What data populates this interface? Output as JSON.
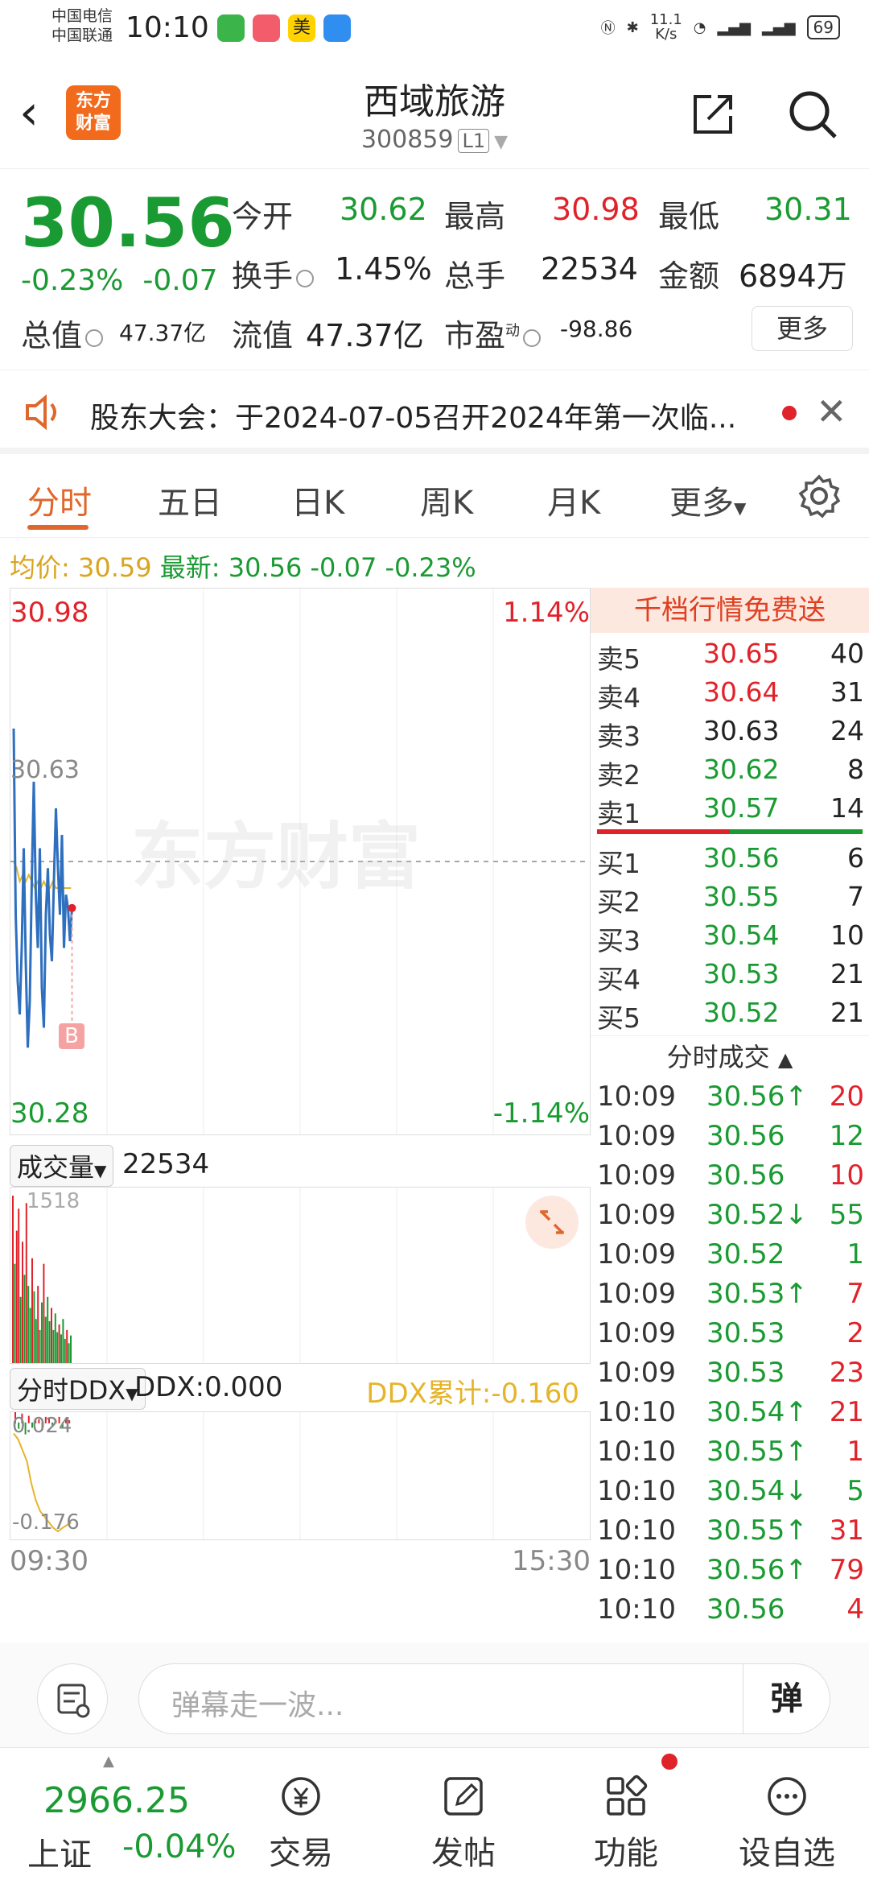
{
  "status": {
    "carrier1": "中国电信",
    "carrier2": "中国联通",
    "time": "10:10",
    "net_speed": "11.1\nK/s",
    "net_speed_val": "11.1",
    "net_speed_unit": "K/s",
    "battery": "69",
    "app_mei": "美"
  },
  "header": {
    "title": "西域旅游",
    "code": "300859",
    "level": "L1",
    "logo_line1": "东方",
    "logo_line2": "财富"
  },
  "quote": {
    "price": "30.56",
    "change_pct": "-0.23%",
    "change": "-0.07",
    "open_label": "今开",
    "open": "30.62",
    "high_label": "最高",
    "high": "30.98",
    "low_label": "最低",
    "low": "30.31",
    "turnover_label": "换手",
    "turnover": "1.45%",
    "volume_label": "总手",
    "volume": "22534",
    "amount_label": "金额",
    "amount": "6894万",
    "mcap_label": "总值",
    "mcap": "47.37亿",
    "float_label": "流值",
    "float": "47.37亿",
    "pe_label": "市盈",
    "pe_sup": "动",
    "pe": "-98.86",
    "more_label": "更多"
  },
  "notice": {
    "text": "股东大会：于2024-07-05召开2024年第一次临..."
  },
  "tabs": [
    "分时",
    "五日",
    "日K",
    "周K",
    "月K",
    "更多"
  ],
  "avg": {
    "avg_label": "均价:",
    "avg_value": "30.59",
    "latest_label": "最新:",
    "latest_value": "30.56",
    "latest_change": "-0.07",
    "latest_pct": "-0.23%"
  },
  "chart": {
    "top_price": "30.98",
    "top_pct": "1.14%",
    "bottom_price": "30.28",
    "bottom_pct": "-1.14%",
    "mid_price": "30.63",
    "watermark": "东方财富",
    "marker": "B",
    "time_start": "09:30",
    "time_end": "15:30"
  },
  "chart_data": {
    "type": "line",
    "ylim": [
      30.28,
      30.98
    ],
    "prev_close": 30.63,
    "price": [
      30.83,
      30.55,
      30.45,
      30.4,
      30.5,
      30.65,
      30.48,
      30.35,
      30.42,
      30.6,
      30.75,
      30.58,
      30.5,
      30.65,
      30.44,
      30.38,
      30.55,
      30.62,
      30.52,
      30.48,
      30.6,
      30.71,
      30.62,
      30.55,
      30.67,
      30.5,
      30.58,
      30.56,
      30.51,
      30.56
    ],
    "avg_price": [
      30.63,
      30.62,
      30.6,
      30.61,
      30.6,
      30.61,
      30.6,
      30.59,
      30.6,
      30.59,
      30.6,
      30.59,
      30.59,
      30.6,
      30.59,
      30.59,
      30.59,
      30.59,
      30.59,
      30.59
    ],
    "volume_max": 1518,
    "volume": [
      1518,
      900,
      1200,
      1400,
      600,
      1100,
      800,
      1450,
      700,
      500,
      950,
      650,
      400,
      700,
      300,
      550,
      900,
      420,
      600,
      380,
      500,
      300,
      450,
      280,
      350,
      260,
      400,
      220,
      300,
      180,
      250
    ],
    "volume_colors": [
      "r",
      "g",
      "r",
      "r",
      "g",
      "r",
      "g",
      "r",
      "g",
      "g",
      "r",
      "g",
      "g",
      "r",
      "g",
      "g",
      "r",
      "g",
      "g",
      "g",
      "r",
      "g",
      "g",
      "g",
      "r",
      "g",
      "g",
      "g",
      "r",
      "g",
      "g"
    ],
    "ddx_top": "0.024",
    "ddx_bottom": "-0.176",
    "ddx_cumulative": [
      0.0,
      -0.01,
      -0.03,
      -0.05,
      -0.09,
      -0.12,
      -0.14,
      -0.15,
      -0.16,
      -0.17,
      -0.176,
      -0.17,
      -0.165,
      -0.16
    ],
    "ddx_bars": [
      0.01,
      -0.005,
      0.008,
      -0.01,
      0.006,
      -0.004,
      0.004,
      0.003,
      -0.006,
      0.005,
      0.004,
      -0.003,
      0.002,
      0.005,
      -0.004,
      0.003,
      0.002
    ]
  },
  "volume_panel": {
    "label": "成交量",
    "value": "22534",
    "max_label": "1518"
  },
  "ddx_panel": {
    "label": "分时DDX",
    "ddx": "DDX:0.000",
    "cum": "DDX累计:-0.160"
  },
  "book": {
    "head": "千档行情免费送",
    "asks": [
      {
        "label": "卖5",
        "price": "30.65",
        "vol": "40",
        "color": "red"
      },
      {
        "label": "卖4",
        "price": "30.64",
        "vol": "31",
        "color": "red"
      },
      {
        "label": "卖3",
        "price": "30.63",
        "vol": "24",
        "color": "black"
      },
      {
        "label": "卖2",
        "price": "30.62",
        "vol": "8",
        "color": "green"
      },
      {
        "label": "卖1",
        "price": "30.57",
        "vol": "14",
        "color": "green"
      }
    ],
    "bids": [
      {
        "label": "买1",
        "price": "30.56",
        "vol": "6",
        "color": "green"
      },
      {
        "label": "买2",
        "price": "30.55",
        "vol": "7",
        "color": "green"
      },
      {
        "label": "买3",
        "price": "30.54",
        "vol": "10",
        "color": "green"
      },
      {
        "label": "买4",
        "price": "30.53",
        "vol": "21",
        "color": "green"
      },
      {
        "label": "买5",
        "price": "30.52",
        "vol": "21",
        "color": "green"
      }
    ],
    "ticks_head": "分时成交",
    "ticks": [
      {
        "t": "10:09",
        "p": "30.56",
        "arrow": "↑",
        "v": "20",
        "pc": "green",
        "vc": "red"
      },
      {
        "t": "10:09",
        "p": "30.56",
        "arrow": "",
        "v": "12",
        "pc": "green",
        "vc": "green"
      },
      {
        "t": "10:09",
        "p": "30.56",
        "arrow": "",
        "v": "10",
        "pc": "green",
        "vc": "red"
      },
      {
        "t": "10:09",
        "p": "30.52",
        "arrow": "↓",
        "v": "55",
        "pc": "green",
        "vc": "green"
      },
      {
        "t": "10:09",
        "p": "30.52",
        "arrow": "",
        "v": "1",
        "pc": "green",
        "vc": "green"
      },
      {
        "t": "10:09",
        "p": "30.53",
        "arrow": "↑",
        "v": "7",
        "pc": "green",
        "vc": "red"
      },
      {
        "t": "10:09",
        "p": "30.53",
        "arrow": "",
        "v": "2",
        "pc": "green",
        "vc": "red"
      },
      {
        "t": "10:09",
        "p": "30.53",
        "arrow": "",
        "v": "23",
        "pc": "green",
        "vc": "red"
      },
      {
        "t": "10:10",
        "p": "30.54",
        "arrow": "↑",
        "v": "21",
        "pc": "green",
        "vc": "red"
      },
      {
        "t": "10:10",
        "p": "30.55",
        "arrow": "↑",
        "v": "1",
        "pc": "green",
        "vc": "red"
      },
      {
        "t": "10:10",
        "p": "30.54",
        "arrow": "↓",
        "v": "5",
        "pc": "green",
        "vc": "green"
      },
      {
        "t": "10:10",
        "p": "30.55",
        "arrow": "↑",
        "v": "31",
        "pc": "green",
        "vc": "red"
      },
      {
        "t": "10:10",
        "p": "30.56",
        "arrow": "↑",
        "v": "79",
        "pc": "green",
        "vc": "red"
      },
      {
        "t": "10:10",
        "p": "30.56",
        "arrow": "",
        "v": "4",
        "pc": "green",
        "vc": "red"
      }
    ]
  },
  "danmu": {
    "placeholder": "弹幕走一波...",
    "button": "弹"
  },
  "bottom": {
    "index_value": "2966.25",
    "index_name": "上证",
    "index_change": "-0.04%",
    "nav": [
      "交易",
      "发帖",
      "功能",
      "设自选"
    ]
  },
  "colors": {
    "up": "#e0232b",
    "down": "#1a9a32",
    "accent": "#e0672b",
    "price_line": "#2e6fbf",
    "avg_line": "#e5b42a"
  }
}
